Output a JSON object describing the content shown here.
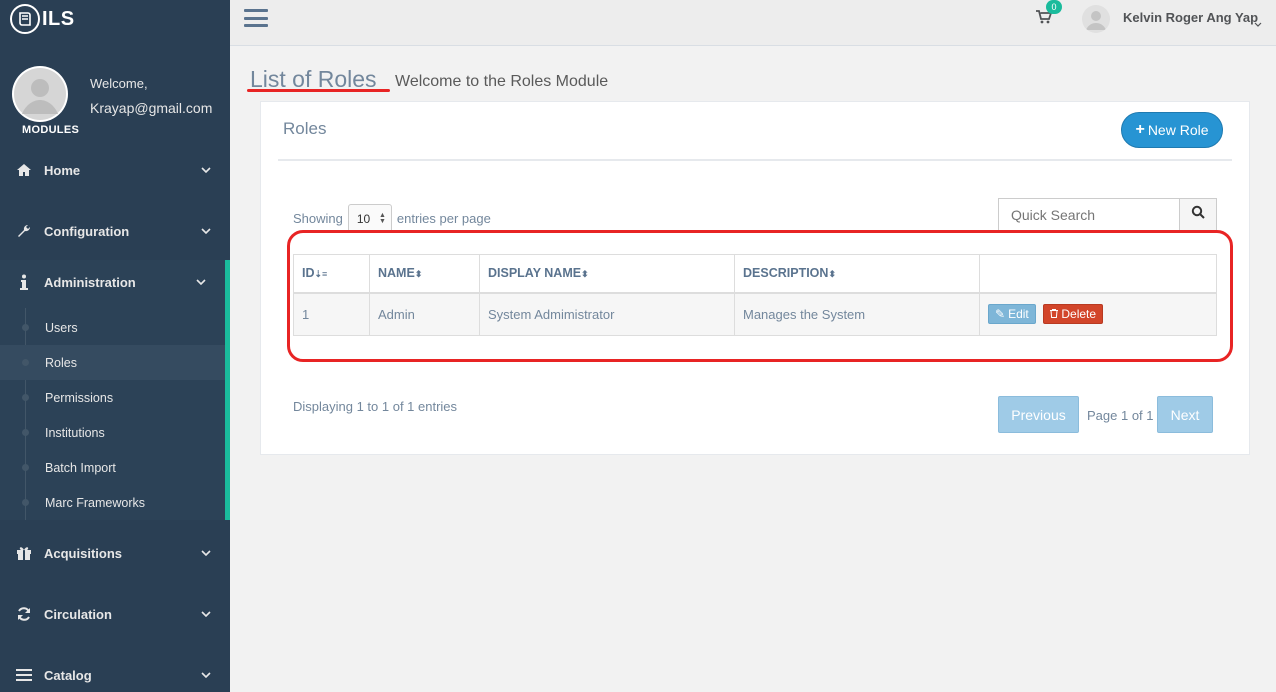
{
  "brand": {
    "name": "ILS"
  },
  "profile": {
    "welcome": "Welcome,",
    "email": "Krayap@gmail.com",
    "section_label": "MODULES"
  },
  "sidebar": {
    "menu": [
      {
        "label": "Home",
        "icon": "home-icon"
      },
      {
        "label": "Configuration",
        "icon": "wrench-icon"
      },
      {
        "label": "Administration",
        "icon": "info-icon"
      },
      {
        "label": "Acquisitions",
        "icon": "gift-icon"
      },
      {
        "label": "Circulation",
        "icon": "refresh-icon"
      },
      {
        "label": "Catalog",
        "icon": "list-icon"
      }
    ],
    "admin_sub": [
      {
        "label": "Users"
      },
      {
        "label": "Roles",
        "active": true
      },
      {
        "label": "Permissions"
      },
      {
        "label": "Institutions"
      },
      {
        "label": "Batch Import"
      },
      {
        "label": "Marc Frameworks"
      }
    ]
  },
  "topnav": {
    "cart_count": "0",
    "user_name": "Kelvin Roger Ang Yap"
  },
  "page": {
    "title": "List of Roles",
    "subtitle": "Welcome to the Roles Module"
  },
  "panel": {
    "title": "Roles",
    "new_button": "New Role",
    "showing_label": "Showing",
    "per_page_value": "10",
    "entries_label": "entries per page",
    "search_placeholder": "Quick Search",
    "columns": [
      "ID",
      "NAME",
      "DISPLAY NAME",
      "DESCRIPTION"
    ],
    "rows": [
      {
        "id": "1",
        "name": "Admin",
        "display_name": "System Admimistrator",
        "description": "Manages the System"
      }
    ],
    "edit_label": "Edit",
    "delete_label": "Delete",
    "displaying": "Displaying 1 to 1 of 1 entries",
    "prev_label": "Previous",
    "page_of": "Page 1 of 1",
    "next_label": "Next"
  },
  "colors": {
    "sidebar": "#2a3f54",
    "accent": "#1abb9c",
    "primary_button": "#2794d3",
    "danger": "#d2452a",
    "annotation": "#e82424"
  }
}
